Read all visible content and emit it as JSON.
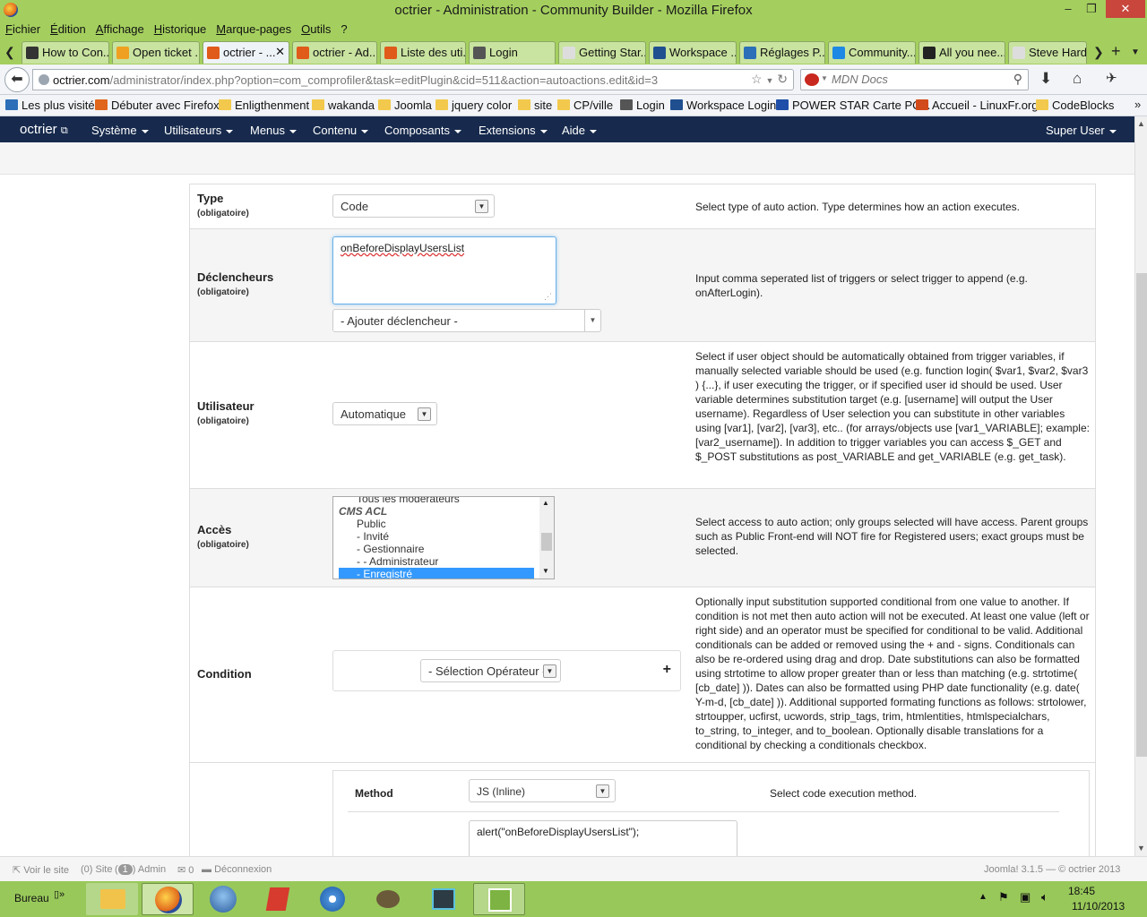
{
  "window": {
    "title": "octrier - Administration - Community Builder - Mozilla Firefox",
    "min": "–",
    "max": "❐",
    "close": "✕"
  },
  "menubar": [
    "Fichier",
    "Édition",
    "Affichage",
    "Historique",
    "Marque-pages",
    "Outils",
    "?"
  ],
  "tabs": [
    {
      "label": "How to Con...",
      "color": "#333"
    },
    {
      "label": "Open ticket ...",
      "color": "#f0a020"
    },
    {
      "label": "octrier - ...",
      "color": "#e05a1a",
      "active": true
    },
    {
      "label": "octrier - Ad...",
      "color": "#e05a1a"
    },
    {
      "label": "Liste des uti...",
      "color": "#e05a1a"
    },
    {
      "label": "Login",
      "color": "#555"
    },
    {
      "label": "Getting Star...",
      "color": "#ddd"
    },
    {
      "label": "Workspace ...",
      "color": "#1f4f8f"
    },
    {
      "label": "Réglages P...",
      "color": "#2a6fb8"
    },
    {
      "label": "Community...",
      "color": "#1e88e5"
    },
    {
      "label": "All you nee...",
      "color": "#222"
    },
    {
      "label": "Steve Hardi...",
      "color": "#ddd"
    }
  ],
  "tab_close": "✕",
  "nav": {
    "url_host": "octrier.com",
    "url_path": "/administrator/index.php?option=com_comprofiler&task=editPlugin&cid=511&action=autoactions.edit&id=3",
    "search_placeholder": "MDN Docs"
  },
  "bookmarks": [
    "Les plus visités",
    "Débuter avec Firefox",
    "Enligthenment",
    "wakanda",
    "Joomla",
    "jquery color",
    "site",
    "CP/ville",
    "Login",
    "Workspace Login",
    "POWER STAR Carte PC...",
    "Accueil - LinuxFr.org",
    "CodeBlocks"
  ],
  "joomla_nav": {
    "brand": "octrier",
    "menus": [
      "Système",
      "Utilisateurs",
      "Menus",
      "Contenu",
      "Composants",
      "Extensions",
      "Aide"
    ],
    "user": "Super User"
  },
  "form": {
    "required": "(obligatoire)",
    "type": {
      "label": "Type",
      "value": "Code",
      "desc": "Select type of auto action. Type determines how an action executes."
    },
    "triggers": {
      "label": "Déclencheurs",
      "value": "onBeforeDisplayUsersList",
      "add_select": "- Ajouter déclencheur -",
      "desc": "Input comma seperated list of triggers or select trigger to append (e.g. onAfterLogin)."
    },
    "user": {
      "label": "Utilisateur",
      "value": "Automatique",
      "desc": "Select if user object should be automatically obtained from trigger variables, if manually selected variable should be used (e.g. function login( $var1, $var2, $var3 ) {...}, if user executing the trigger, or if specified user id should be used. User variable determines substitution target (e.g. [username] will output the User username). Regardless of User selection you can substitute in other variables using [var1], [var2], [var3], etc.. (for arrays/objects use [var1_VARIABLE]; example: [var2_username]). In addition to trigger variables you can access $_GET and $_POST substitutions as post_VARIABLE and get_VARIABLE (e.g. get_task)."
    },
    "access": {
      "label": "Accès",
      "options": [
        "Tous les modérateurs",
        "CMS ACL",
        "Public",
        "- Invité",
        "- Gestionnaire",
        "- - Administrateur",
        "- Enregistré"
      ],
      "selected": "- Enregistré",
      "desc": "Select access to auto action; only groups selected will have access. Parent groups such as Public Front-end will NOT fire for Registered users; exact groups must be selected."
    },
    "condition": {
      "label": "Condition",
      "operator": "- Sélection Opérateur -",
      "add": "+",
      "desc": "Optionally input substitution supported conditional from one value to another. If condition is not met then auto action will not be executed. At least one value (left or right side) and an operator must be specified for conditional to be valid. Additional conditionals can be added or removed using the + and - signs. Conditionals can also be re-ordered using drag and drop. Date substitutions can also be formatted using strtotime to allow proper greater than or less than matching (e.g. strtotime( [cb_date] )). Dates can also be formatted using PHP date functionality (e.g. date( Y-m-d, [cb_date] )). Additional supported formating functions as follows: strtolower, strtoupper, ucfirst, ucwords, strip_tags, trim, htmlentities, htmlspecialchars, to_string, to_integer, and to_boolean. Optionally disable translations for a conditional by checking a conditionals checkbox."
    },
    "method": {
      "label": "Method",
      "value": "JS (Inline)",
      "desc": "Select code execution method.",
      "code": "alert(\"onBeforeDisplayUsersList\");"
    }
  },
  "status": {
    "view_site": "Voir le site",
    "site_count": "(0) Site",
    "admin_count": "1",
    "admin": "Admin",
    "msg_count": "0",
    "logout": "Déconnexion",
    "version": "Joomla! 3.1.5 — © octrier 2013"
  },
  "taskbar": {
    "desktop": "Bureau",
    "time": "18:45",
    "date": "11/10/2013"
  }
}
